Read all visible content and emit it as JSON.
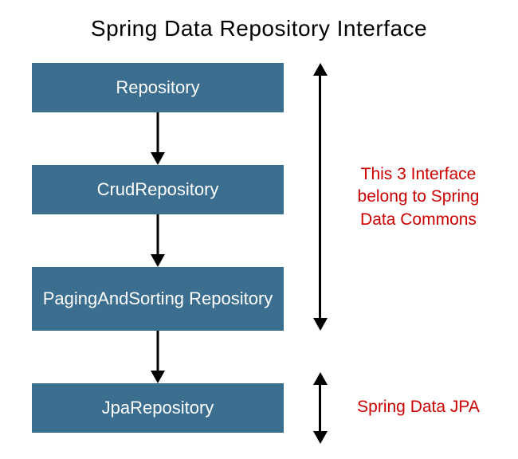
{
  "title": "Spring Data Repository Interface",
  "boxes": {
    "repository": "Repository",
    "crud": "CrudRepository",
    "paging": "PagingAndSorting Repository",
    "jpa": "JpaRepository"
  },
  "annotations": {
    "commons": "This 3 Interface belong to Spring Data Commons",
    "jpa": "Spring Data JPA"
  }
}
